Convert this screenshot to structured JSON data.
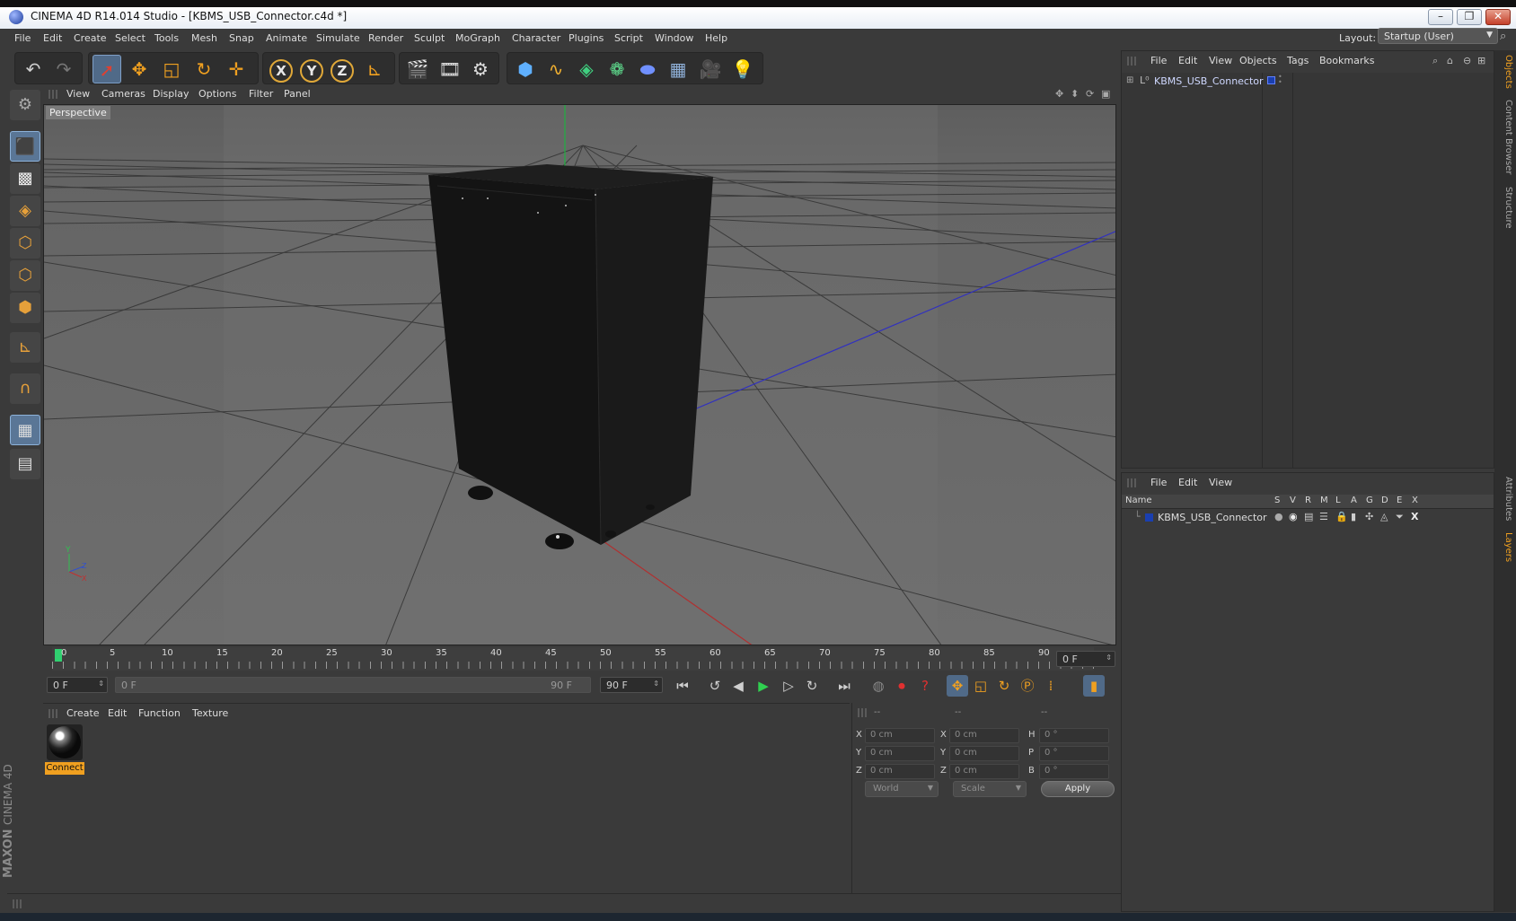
{
  "window": {
    "title": "CINEMA 4D R14.014 Studio - [KBMS_USB_Connector.c4d *]",
    "minimize": "–",
    "restore": "❐",
    "close": "✕"
  },
  "menubar": {
    "items": [
      "File",
      "Edit",
      "Create",
      "Select",
      "Tools",
      "Mesh",
      "Snap",
      "Animate",
      "Simulate",
      "Render",
      "Sculpt",
      "MoGraph",
      "Character",
      "Plugins",
      "Script",
      "Window",
      "Help"
    ],
    "layout_label": "Layout:",
    "layout_value": "Startup (User)"
  },
  "viewport": {
    "menu": [
      "View",
      "Cameras",
      "Display",
      "Options",
      "Filter",
      "Panel"
    ],
    "label": "Perspective"
  },
  "timeline": {
    "ticks": [
      "0",
      "5",
      "10",
      "15",
      "20",
      "25",
      "30",
      "35",
      "40",
      "45",
      "50",
      "55",
      "60",
      "65",
      "70",
      "75",
      "80",
      "85",
      "90"
    ],
    "current_frame_field": "0 F",
    "start_field": "0 F",
    "range_start": "0 F",
    "range_end": "90 F",
    "end_field": "90 F"
  },
  "material_manager": {
    "menu": [
      "Create",
      "Edit",
      "Function",
      "Texture"
    ],
    "materials": [
      {
        "name": "Connect"
      }
    ]
  },
  "coordinates": {
    "headers": [
      "--",
      "--",
      "--"
    ],
    "rows": [
      {
        "axis1": "X",
        "pos": "0 cm",
        "axis2": "X",
        "size": "0 cm",
        "axis3": "H",
        "rot": "0 °"
      },
      {
        "axis1": "Y",
        "pos": "0 cm",
        "axis2": "Y",
        "size": "0 cm",
        "axis3": "P",
        "rot": "0 °"
      },
      {
        "axis1": "Z",
        "pos": "0 cm",
        "axis2": "Z",
        "size": "0 cm",
        "axis3": "B",
        "rot": "0 °"
      }
    ],
    "mode_dropdown": "World",
    "type_dropdown": "Scale",
    "apply_label": "Apply"
  },
  "object_manager": {
    "menu": [
      "File",
      "Edit",
      "View",
      "Objects",
      "Tags",
      "Bookmarks"
    ],
    "objects": [
      {
        "name": "KBMS_USB_Connector",
        "color": "#1a3fb0"
      }
    ]
  },
  "layer_manager": {
    "menu": [
      "File",
      "Edit",
      "View"
    ],
    "columns": [
      "Name",
      "S",
      "V",
      "R",
      "M",
      "L",
      "A",
      "G",
      "D",
      "E",
      "X"
    ],
    "layers": [
      {
        "name": "KBMS_USB_Connector"
      }
    ]
  },
  "right_tabs": [
    "Objects",
    "Content Browser",
    "Structure",
    "Attributes",
    "Layers"
  ],
  "branding": {
    "maxon": "MAXON",
    "product": "CINEMA 4D"
  },
  "colors": {
    "accent_orange": "#f0a020",
    "selection_blue": "#5a7696",
    "grid_x": "#b03030",
    "grid_z": "#3030c0",
    "grid_y": "#20b040"
  }
}
